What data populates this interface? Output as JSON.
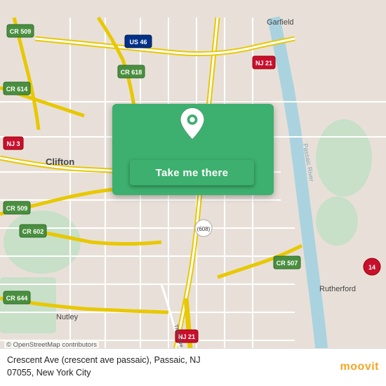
{
  "map": {
    "background_color": "#e8e0d8",
    "center_lat": 40.856,
    "center_lon": -74.124
  },
  "button": {
    "label": "Take me there",
    "background_color": "#3daf6e"
  },
  "attribution": {
    "text": "© OpenStreetMap contributors"
  },
  "address": {
    "line1": "Crescent Ave (crescent ave passaic), Passaic, NJ",
    "line2": "07055, New York City"
  },
  "logo": {
    "text": "moovit"
  },
  "roads": {
    "color_yellow": "#f5e642",
    "color_white": "#ffffff",
    "color_road": "#ffffff",
    "color_highway_bg": "#f7a900",
    "color_water": "#aad3df",
    "color_green": "#c8dfc8"
  }
}
